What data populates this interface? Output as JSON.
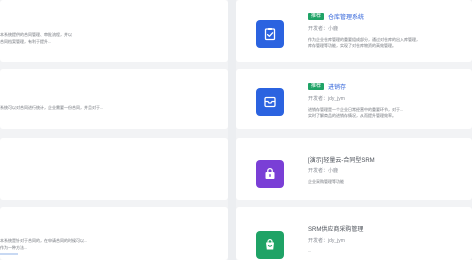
{
  "left_cards": [
    {
      "lines": [
        "本系统提供的合同管理、审批流程，并以",
        "合同档案管理，有利于提升..."
      ]
    },
    {
      "lines": [
        "系统可以对合同进行统计，企业需要一份合同，并且对于..."
      ]
    },
    {
      "lines": []
    },
    {
      "lines": [
        "本系统是针对于合同的，在申请合同的时候可以...",
        "作为一种方法..."
      ]
    }
  ],
  "right_cards": [
    {
      "tag": "推荐",
      "title": "仓库管理系统",
      "developer": "开发者：小鹿",
      "desc": [
        "作为企业仓库管理的重要组成部分，通过对仓库的出入库管理，",
        "库存管理等功能，实现了对仓库物资的高效管理。"
      ],
      "icon": "clipboard-check-icon",
      "icon_color": "#2b63e0"
    },
    {
      "tag": "推荐",
      "title": "进销存",
      "developer": "开发者：jdy_jym",
      "desc": [
        "进销存管理是一个企业日常经营中的重要环节，对于...",
        "实时了解商品的进销存情况，从而提升管理效率。"
      ],
      "icon": "inbox-icon",
      "icon_color": "#2b63e0"
    },
    {
      "tag": "",
      "title": "[演示]轻量云-合同型SRM",
      "developer": "开发者：小鹿",
      "desc": [
        "企业采购管理等功能"
      ],
      "icon": "lock-bag-icon",
      "icon_color": "#7a3fd6"
    },
    {
      "tag": "",
      "title": "SRM供应商采购管理",
      "developer": "开发者：jdy_jym",
      "desc": [
        "..."
      ],
      "icon": "cart-icon",
      "icon_color": "#1fa366"
    }
  ]
}
